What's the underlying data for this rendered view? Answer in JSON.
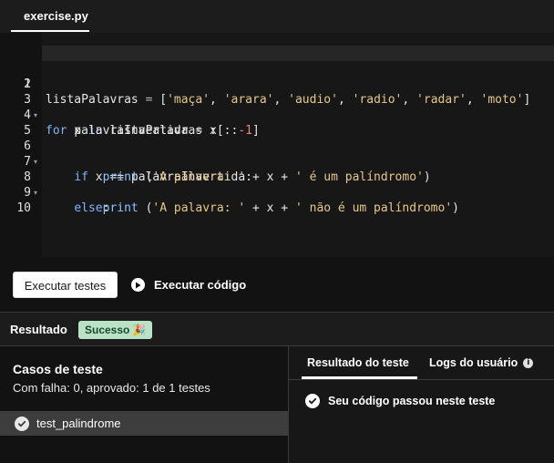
{
  "editor": {
    "tab_label": "exercise.py",
    "lines": [
      {
        "n": "1",
        "fold": ""
      },
      {
        "n": "2",
        "fold": ""
      },
      {
        "n": "3",
        "fold": "▾"
      },
      {
        "n": "4",
        "fold": ""
      },
      {
        "n": "5",
        "fold": ""
      },
      {
        "n": "6",
        "fold": "▾"
      },
      {
        "n": "7",
        "fold": ""
      },
      {
        "n": "8",
        "fold": "▾"
      },
      {
        "n": "9",
        "fold": ""
      },
      {
        "n": "10",
        "fold": ""
      }
    ],
    "code": {
      "l1": {
        "var": "listaPalavras",
        "eq": " = ",
        "open": "[",
        "s1": "'maça'",
        "s2": "'arara'",
        "s3": "'audio'",
        "s4": "'radio'",
        "s5": "'radar'",
        "s6": "'moto'",
        "close": "]",
        "comma": ", "
      },
      "l3": {
        "kw_for": "for",
        "var_x": " x ",
        "kw_in": "in",
        "rest": " listaPalavras :"
      },
      "l4": {
        "indent": "    ",
        "lhs": "palavraInvertida",
        "eq": " = ",
        "rhs": "x[::",
        "num": "-1",
        "end": "]"
      },
      "l6": {
        "indent": "    ",
        "kw_if": "if",
        "rest": " x == palavraInvertida:"
      },
      "l7": {
        "indent": "        ",
        "fn": "print",
        "open": " (",
        "s1": "'A palavra: '",
        "mid": " + x + ",
        "s2": "' é um palíndromo'",
        "close": ")"
      },
      "l8": {
        "indent": "    ",
        "kw_else": "else",
        "rest": ":"
      },
      "l9": {
        "indent": "        ",
        "fn": "print",
        "open": " (",
        "s1": "'A palavra: '",
        "mid": " + x + ",
        "s2": "' não é um palíndromo'",
        "close": ")"
      }
    }
  },
  "actions": {
    "run_tests_label": "Executar testes",
    "run_code_label": "Executar código"
  },
  "result": {
    "title": "Resultado",
    "badge_label": "Sucesso",
    "badge_icon": "🎉"
  },
  "cases": {
    "title": "Casos de teste",
    "summary": "Com falha: 0, aprovado: 1 de 1 testes",
    "items": [
      {
        "label": "test_palindrome"
      }
    ]
  },
  "right_pane": {
    "tabs": [
      {
        "label": "Resultado do teste"
      },
      {
        "label": "Logs do usuário"
      }
    ],
    "info_glyph": "i",
    "pass_message": "Seu código passou neste teste"
  },
  "colors": {
    "accent": "#ffffff",
    "success_badge": "#b9e3c4",
    "editor_bg": "#171717"
  }
}
